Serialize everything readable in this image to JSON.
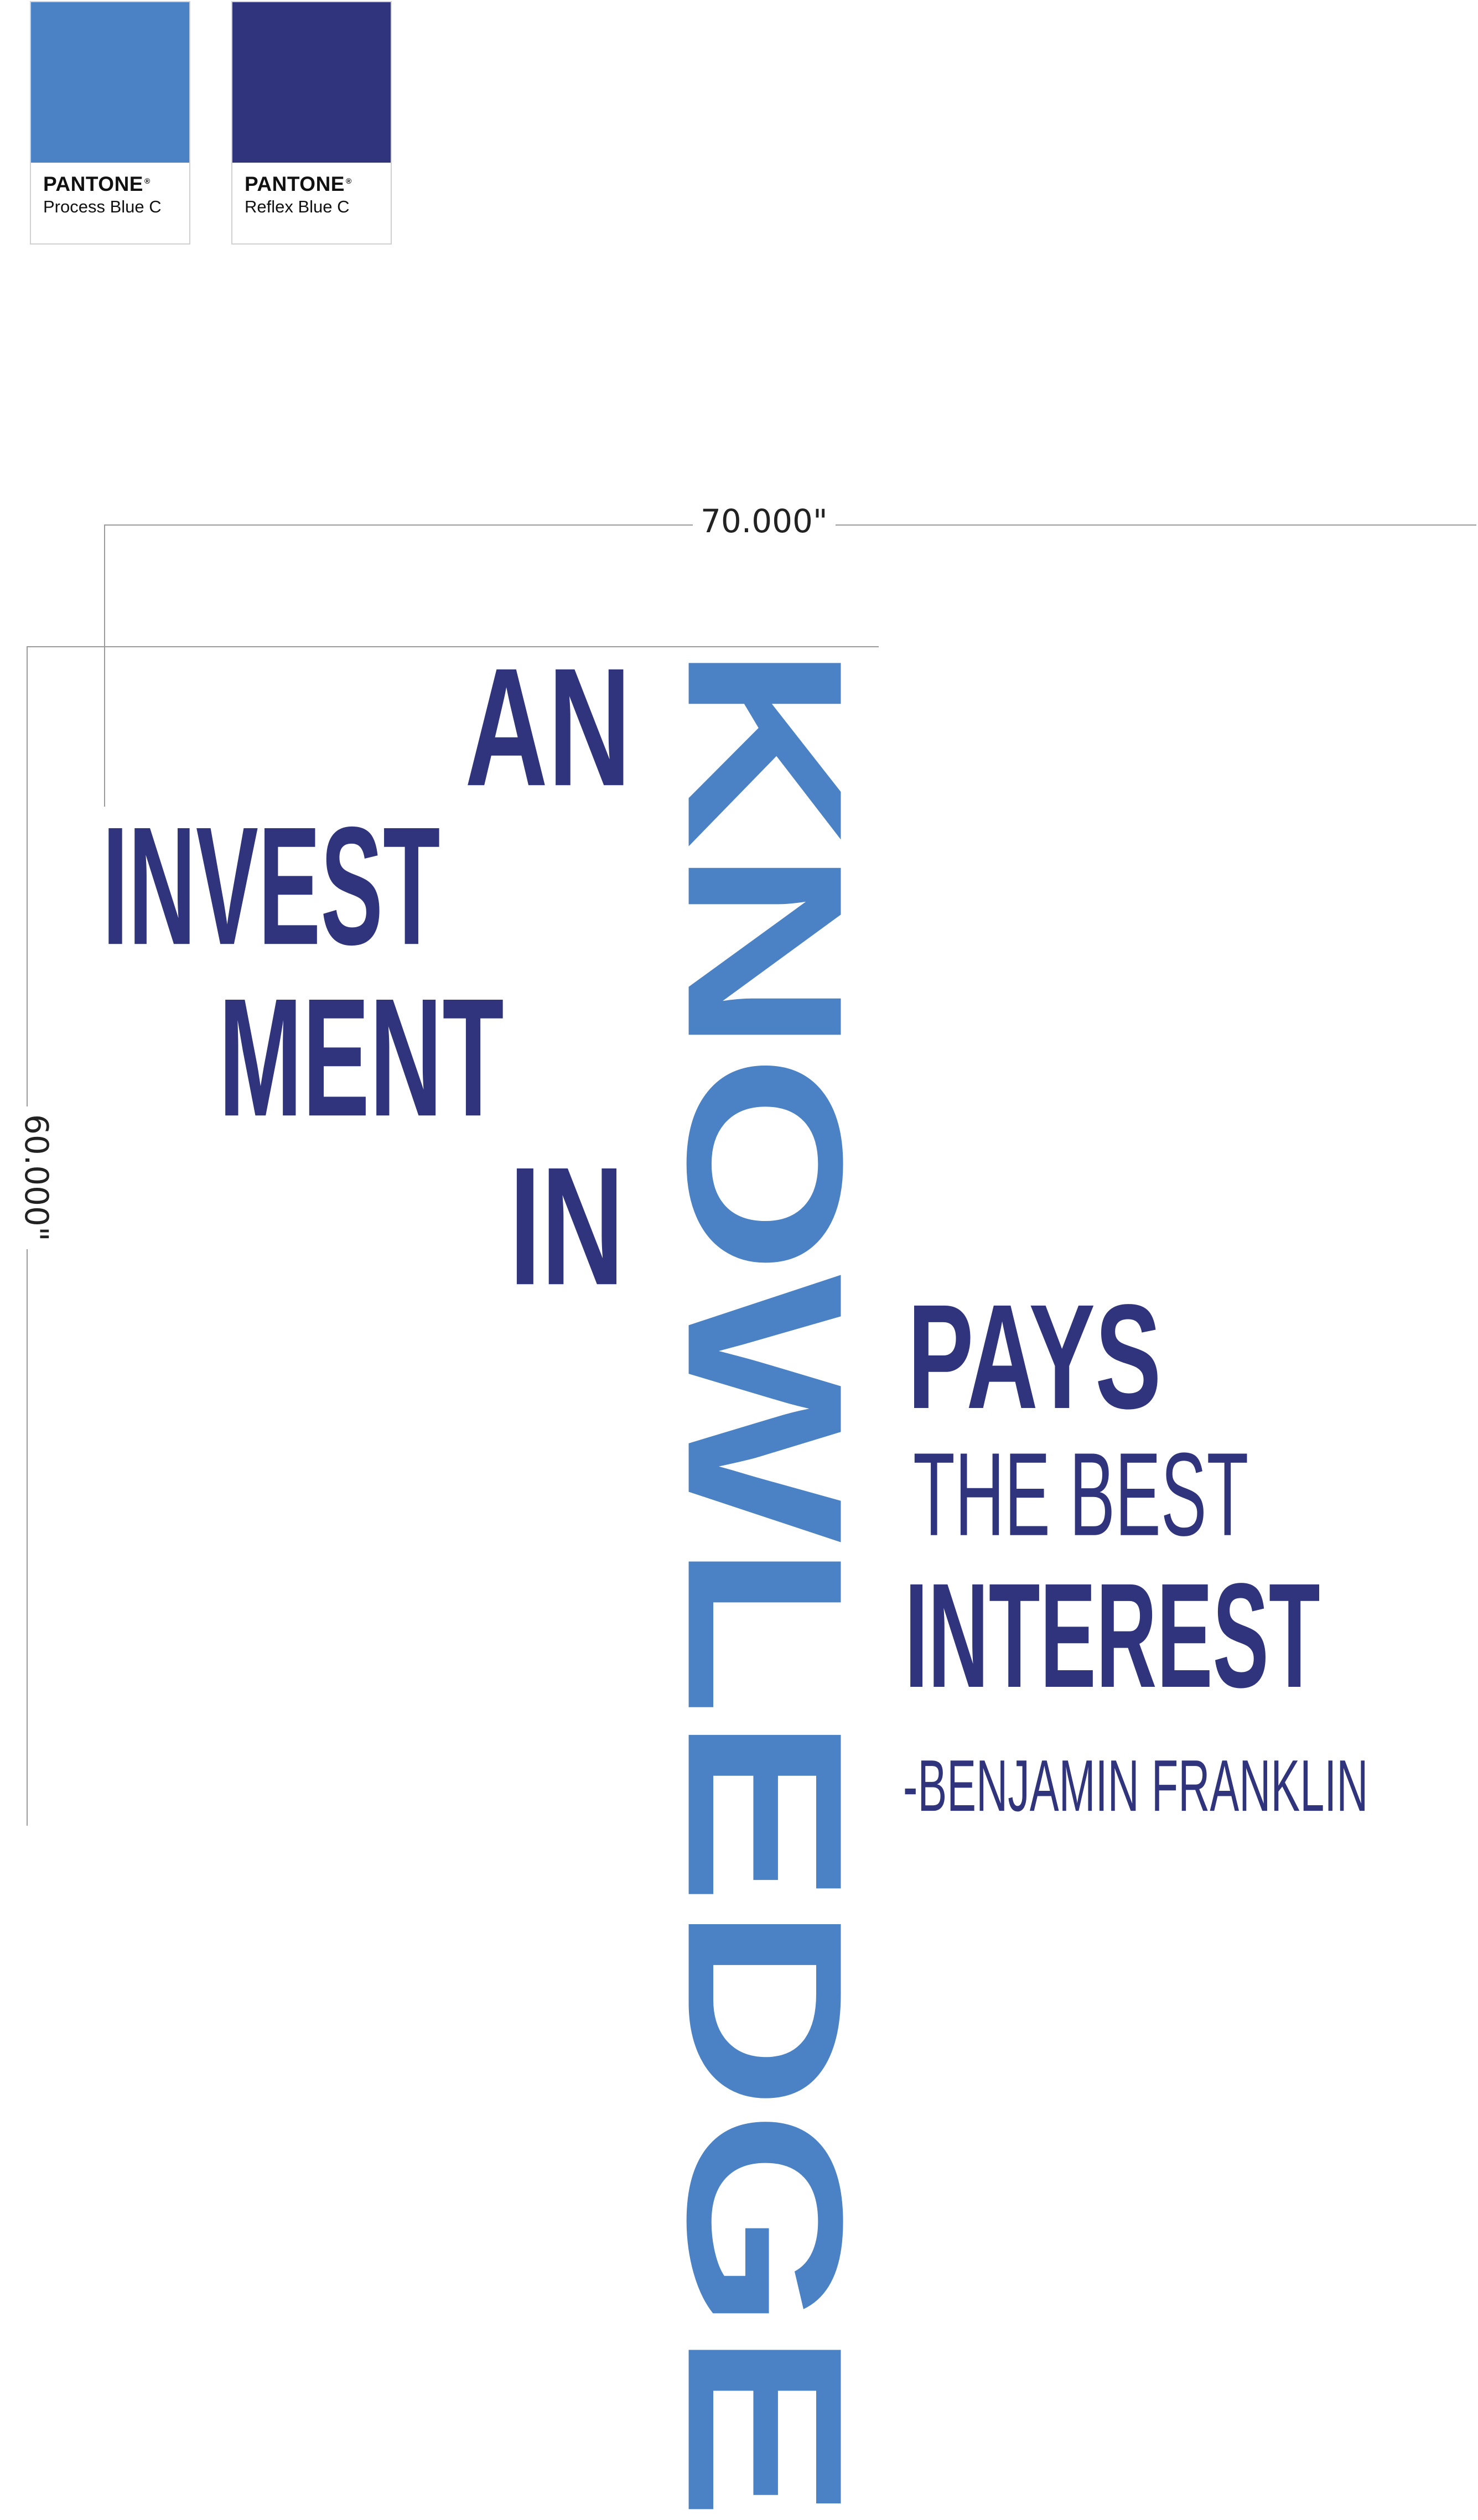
{
  "swatches": [
    {
      "brand": "PANTONE",
      "reg": "®",
      "name": "Process Blue C",
      "color": "#4A82C5"
    },
    {
      "brand": "PANTONE",
      "reg": "®",
      "name": "Reflex Blue C",
      "color": "#2F347C"
    }
  ],
  "dimensions": {
    "width": "70.000\"",
    "height": "60.000\""
  },
  "quote": {
    "line1": "AN",
    "line2": "INVEST",
    "line3": "MENT",
    "line4": "IN",
    "vertical_word": "KNOWLEDGE",
    "line5": "PAYS",
    "line6": "THE BEST",
    "line7": "INTEREST",
    "attribution": "-BENJAMIN FRANKLIN"
  },
  "colors": {
    "process_blue": "#4A82C5",
    "reflex_blue": "#2F347C"
  }
}
